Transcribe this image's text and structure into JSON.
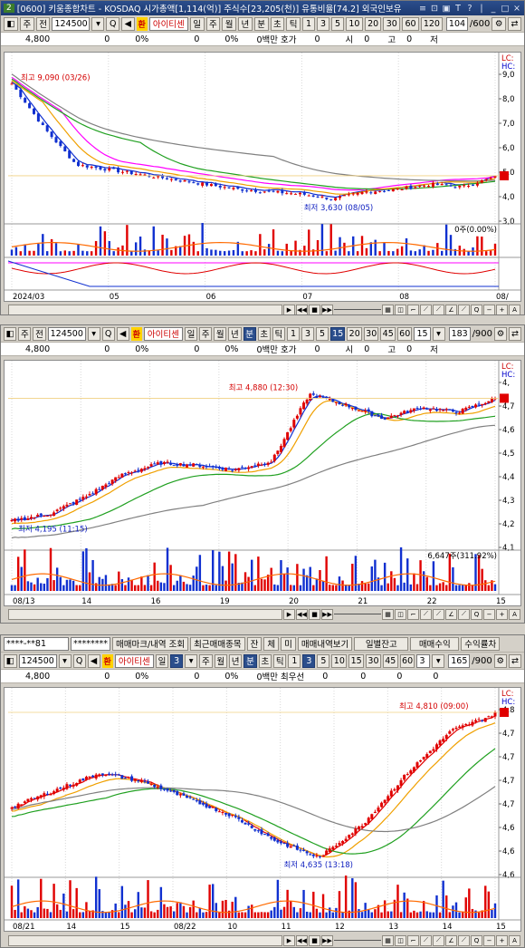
{
  "window": {
    "app_number": "2",
    "title": "[0600] 키움종합차트 - KOSDAQ 시가총액[1,114(억)] 주식수[23,205(천)] 유통비율[74.2] 외국인보유",
    "title_buttons": [
      "≡",
      "⊡",
      "▣",
      "T",
      "?",
      "|",
      "_",
      "□",
      "×"
    ]
  },
  "stock": {
    "code": "124500",
    "name": "아이티센",
    "han_badge": "환"
  },
  "panels": [
    {
      "id": "daily",
      "toolbar": {
        "type1": "주",
        "type2": "전",
        "periods": [
          "일",
          "주",
          "월",
          "년",
          "분",
          "초",
          "틱"
        ],
        "intervals": [
          "1",
          "3",
          "5",
          "10",
          "20",
          "30",
          "60",
          "120"
        ],
        "selected_period": "",
        "count": "104",
        "count_total": "/600"
      },
      "quote": {
        "price": "4,800",
        "change": "0",
        "change_pct": "0%",
        "volume": "0",
        "vol_pct": "0%",
        "amount_label": "0백만 호가",
        "hoga": "0",
        "si_label": "시",
        "si": "0",
        "go_label": "고",
        "go": "0",
        "jeo_label": "저",
        "jeo": "0"
      },
      "axis_right": [
        "9,0",
        "8,0",
        "7,0",
        "6,0",
        "5,0",
        "4,0",
        "3,0"
      ],
      "lc_hc": [
        "LC:",
        "HC:"
      ],
      "high_label": "최고 9,090 (03/26)",
      "low_label": "최저 3,630 (08/05)",
      "vol_label": "0주(0.00%)",
      "x_labels": [
        "2024/03",
        "05",
        "06",
        "07",
        "08",
        "08/"
      ]
    },
    {
      "id": "minute",
      "toolbar": {
        "type1": "주",
        "type2": "전",
        "periods": [
          "일",
          "주",
          "월",
          "년",
          "분",
          "초",
          "틱"
        ],
        "intervals": [
          "1",
          "3",
          "5",
          "15",
          "20",
          "30",
          "45",
          "60"
        ],
        "selected_interval": "15",
        "interval_value": "15",
        "count": "183",
        "count_total": "/900"
      },
      "quote": {
        "price": "4,800",
        "change": "0",
        "change_pct": "0%",
        "volume": "0",
        "vol_pct": "0%",
        "amount_label": "0백만 호가",
        "hoga": "0",
        "si_label": "시",
        "si": "0",
        "go_label": "고",
        "go": "0",
        "jeo_label": "저",
        "jeo": "0"
      },
      "axis_right": [
        "4,",
        "4,7",
        "4,6",
        "4,5",
        "4,4",
        "4,3",
        "4,2",
        "4,1"
      ],
      "lc_hc": [
        "LC:",
        "HC:"
      ],
      "high_label": "최고 4,880 (12:30)",
      "low_label": "최저 4,195 (11:15)",
      "vol_label": "6,647주(311.92%)",
      "x_labels": [
        "08/13",
        "14",
        "16",
        "19",
        "20",
        "21",
        "22",
        "15"
      ]
    },
    {
      "id": "tick",
      "top_bar": {
        "account": "****-**81",
        "password": "********",
        "buttons": [
          "매매마크/내역 조회",
          "최근매매종목",
          "잔",
          "체",
          "미",
          "매매내역보기",
          "일별잔고",
          "매매수익",
          "수익률차"
        ]
      },
      "toolbar": {
        "periods": [
          "일",
          "3"
        ],
        "mini": [
          "주",
          "월",
          "년",
          "분",
          "초",
          "틱"
        ],
        "intervals": [
          "1",
          "3",
          "5",
          "10",
          "15",
          "30",
          "45",
          "60"
        ],
        "interval_value": "3",
        "count": "165",
        "count_total": "/900"
      },
      "quote": {
        "price": "4,800",
        "change": "0",
        "change_pct": "0%",
        "volume": "0",
        "vol_pct": "0%",
        "amount_label": "0백만 최우선",
        "hoga": "0",
        "si": "0",
        "go": "0",
        "jeo": "0"
      },
      "axis_right": [
        "4,8",
        "4,7",
        "4,7",
        "4,7",
        "4,7",
        "4,6",
        "4,6",
        "4,6"
      ],
      "lc_hc": [
        "LC:",
        "HC:"
      ],
      "high_label": "최고 4,810 (09:00)",
      "low_label": "최저 4,635 (13:18)",
      "x_labels": [
        "08/21",
        "14",
        "15",
        "08/22",
        "10",
        "11",
        "12",
        "13",
        "14",
        "15"
      ]
    }
  ],
  "chart_data": [
    {
      "type": "candlestick",
      "title": "",
      "series": [
        {
          "values": [
            8.6,
            6.8,
            5.3,
            5.1,
            4.9,
            4.7,
            4.5,
            4.3,
            4.2,
            4.1,
            3.9,
            4.2,
            4.3,
            4.5,
            4.4,
            4.8
          ]
        }
      ],
      "x": [
        "2024/03",
        "05",
        "06",
        "07",
        "08"
      ],
      "ylim": [
        3.0,
        9.5
      ]
    },
    {
      "type": "candlestick",
      "title": "",
      "series": [
        {
          "values": [
            4.22,
            4.25,
            4.33,
            4.43,
            4.48,
            4.47,
            4.45,
            4.49,
            4.79,
            4.74,
            4.68,
            4.73,
            4.71,
            4.77
          ]
        }
      ],
      "x": [
        "08/13",
        "14",
        "16",
        "19",
        "20",
        "21",
        "22"
      ],
      "ylim": [
        4.1,
        4.9
      ]
    },
    {
      "type": "candlestick",
      "title": "",
      "series": [
        {
          "values": [
            4.7,
            4.72,
            4.74,
            4.73,
            4.71,
            4.69,
            4.66,
            4.64,
            4.68,
            4.74,
            4.79,
            4.81
          ]
        }
      ],
      "x": [
        "08/21",
        "14",
        "15",
        "08/22",
        "10",
        "11",
        "12",
        "13",
        "14",
        "15"
      ],
      "ylim": [
        4.62,
        4.83
      ]
    }
  ],
  "colors": {
    "up": "#e00000",
    "down": "#1030d0",
    "ma_short": "#ff00ff",
    "ma_mid": "#20a020",
    "ma_long": "#808080",
    "ma5": "#f0a000",
    "title_bg": "#1d3a72",
    "selected": "#2b4e8c"
  }
}
